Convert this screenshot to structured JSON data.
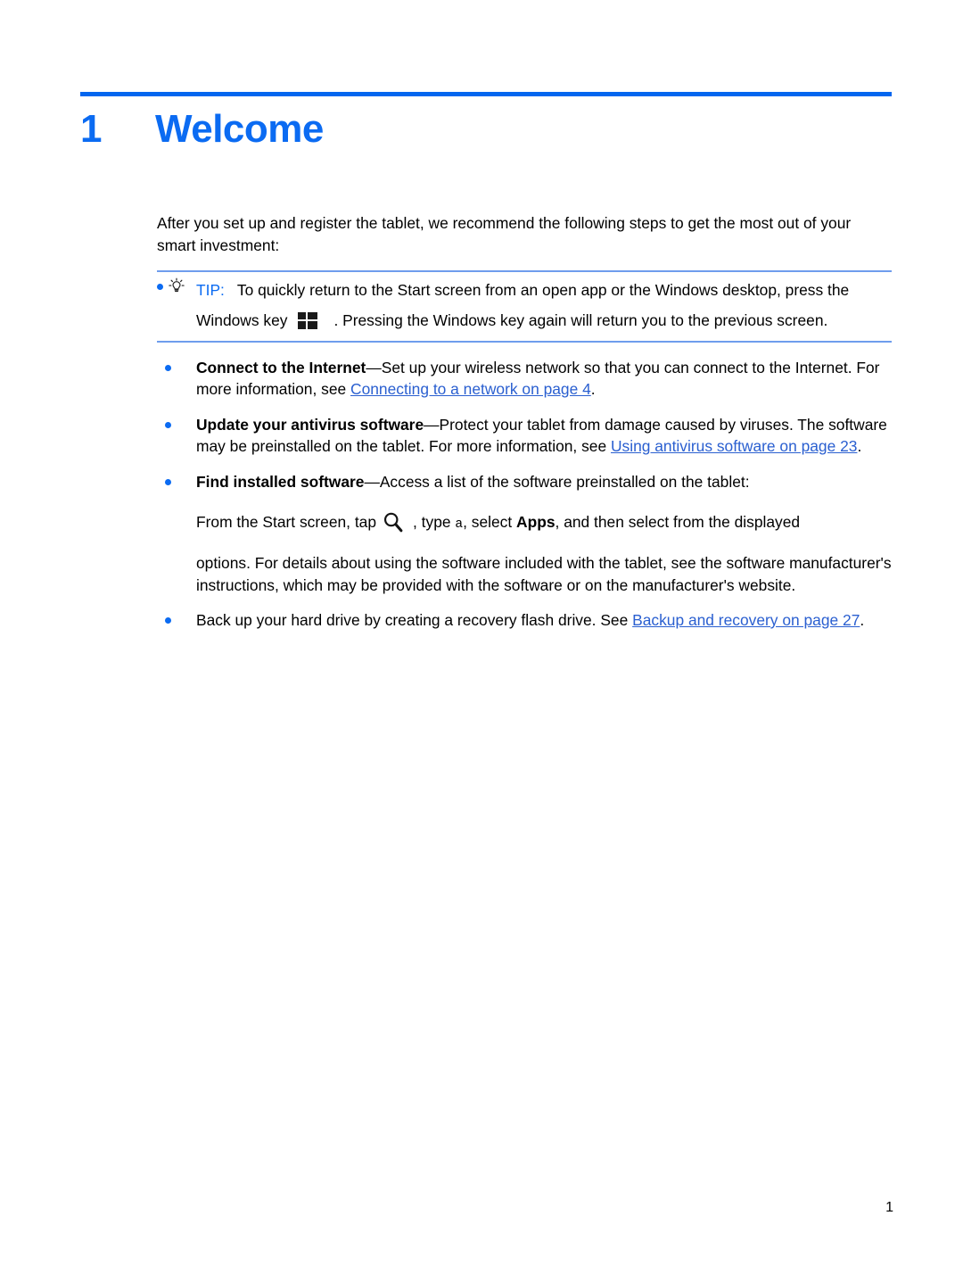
{
  "document": {
    "chapter_number": "1",
    "chapter_title": "Welcome",
    "page_number": "1",
    "accent_color": "#0b6bf2",
    "rule_color": "#0366ef",
    "note_border_color": "#6f9ded",
    "link_color": "#2a5fd0"
  },
  "intro": {
    "text": "After you set up and register the tablet, we recommend the following steps to get the most out of your smart investment:"
  },
  "tip": {
    "bulb_icon": "lightbulb-icon",
    "bullet_icon": "bullet-icon",
    "label": "TIP:",
    "line1": "To quickly return to the Start screen from an open app or the Windows desktop, press the",
    "line2_before": "Windows key",
    "windows_key_icon": "windows-key-icon",
    "line2_after": ". Pressing the Windows key again will return you to the previous screen."
  },
  "bullets": [
    {
      "lead": "Connect to the Internet",
      "body_before": "—Set up your wireless network so that you can connect to the Internet. For more information, see ",
      "link": "Connecting to a network on page 4",
      "body_after": "."
    },
    {
      "lead": "Update your antivirus software",
      "body_before": "—Protect your tablet from damage caused by viruses. The software may be preinstalled on the tablet. For more information, see ",
      "link": "Using antivirus software on page 23",
      "body_after": "."
    },
    {
      "lead": "Find installed software",
      "body_before": "—Access a list of the software preinstalled on the tablet:",
      "link": "",
      "body_after": "",
      "sub_paragraph": {
        "before_icon": "From the Start screen, tap",
        "search_icon": "search-icon",
        "after_icon_1": ", type",
        "typed_key": "a",
        "after_icon_2": ", select",
        "bold_word": "Apps",
        "after_icon_3": ", and then select from the displayed"
      },
      "sub_paragraph_2": "options. For details about using the software included with the tablet, see the software manufacturer's instructions, which may be provided with the software or on the manufacturer's website."
    },
    {
      "lead": "",
      "body_before": "Back up your hard drive by creating a recovery flash drive. See ",
      "link": "Backup and recovery on page 27",
      "body_after": "."
    }
  ]
}
